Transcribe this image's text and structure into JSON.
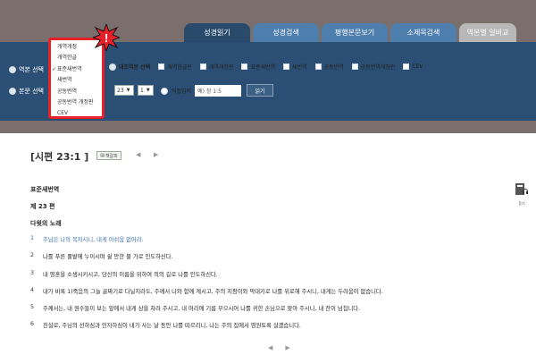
{
  "tabs": [
    {
      "label": "성경읽기"
    },
    {
      "label": "성경검색"
    },
    {
      "label": "평행본문보기"
    },
    {
      "label": "소제목검색"
    },
    {
      "label": "역본별 일비교"
    }
  ],
  "toolbar": {
    "version_select_label": "역본 선택",
    "passage_select_label": "본문 선택",
    "compare_label": "대조역본 선택",
    "compare_versions": [
      "개역한글판",
      "개역개정판",
      "표준새번역",
      "새번역",
      "공동번역",
      "공동번역개정판",
      "CEV"
    ],
    "chapter_value": "23",
    "verse_value": "1",
    "direct_input_label": "직접입력",
    "direct_input_value": "예) 창 1:5",
    "read_button": "읽기"
  },
  "dropdown": {
    "items": [
      "개역개정",
      "개역한글",
      "표준새번역",
      "새번역",
      "공동번역",
      "공동번역 개정판",
      "CEV"
    ],
    "checked_index": 2,
    "check_mark": "✓"
  },
  "alert": {
    "mark": "!"
  },
  "reader": {
    "reference": "[시편 23:1 ]",
    "reference_button": "책갈피",
    "prev_arrow": "◀",
    "next_arrow": "▶",
    "version_name": "표준새번역",
    "chapter_label": "제 23 편",
    "psalm_title": "다윗의 노래",
    "side_icon_label": "듣기",
    "verses": [
      {
        "num": "1",
        "text": "주님은 나의 목자시니, 내게 아쉬움 없어라."
      },
      {
        "num": "2",
        "text": "나를 푸른 풀밭에 누이시며 쉴 만한 물 가로 인도하신다."
      },
      {
        "num": "3",
        "text": "내 영혼을 소생시키시고, 당신의 이름을 위하여 의의 길로 나를 인도하신다."
      },
      {
        "num": "4",
        "text": "내가 비록 1)죽음의 그늘 골짜기로 다닐지라도, 주께서 나와 함께 계시고, 주의 지팡이와 막대기로 나를 위로해 주시니, 내게는 두려움이 없습니다."
      },
      {
        "num": "5",
        "text": "주께서는, 내 원수들이 보는 앞에서 내게 상을 차려 주시고, 내 머리에 기름 부으시어 나를 귀한 손님으로 맞아 주시니, 내 잔이 넘칩니다."
      },
      {
        "num": "6",
        "text": "진실로, 주님의 선하심과 인자하심이 내가 사는 날 동안 나를 따르리니, 나는 주의 집에서 영원토록 살겠습니다."
      }
    ]
  },
  "colors": {
    "toolbar_bg": "#2b4f74",
    "tab": "#4e7fae",
    "tab_active": "#2a4a6c",
    "alert": "#e8202a",
    "highlight": "#3a6fb0"
  }
}
